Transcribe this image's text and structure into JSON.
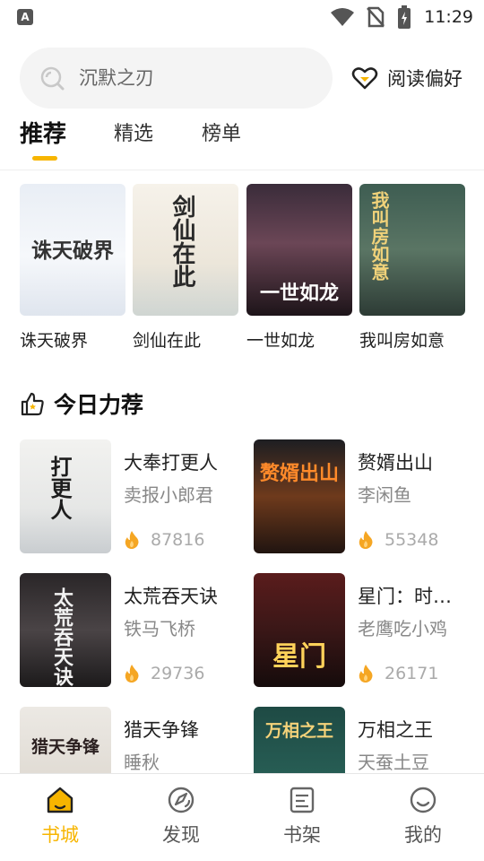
{
  "status_bar": {
    "app_badge": "A",
    "time": "11:29"
  },
  "search": {
    "text": "沉默之刃",
    "icon": "search-icon"
  },
  "preference": {
    "label": "阅读偏好",
    "icon": "heart-icon"
  },
  "tabs": [
    {
      "label": "推荐",
      "active": true
    },
    {
      "label": "精选",
      "active": false
    },
    {
      "label": "榜单",
      "active": false
    }
  ],
  "top_books": [
    {
      "title": "诛天破界",
      "cover_title": "诛天破界"
    },
    {
      "title": "剑仙在此",
      "cover_title": "剑仙在此"
    },
    {
      "title": "一世如龙",
      "cover_title": "一世如龙"
    },
    {
      "title": "我叫房如意",
      "cover_title": "我叫房如意"
    }
  ],
  "section": {
    "title": "今日力荐",
    "icon": "thumbs-up-icon"
  },
  "recommend": [
    {
      "title": "大奉打更人",
      "author": "卖报小郎君",
      "heat": "87816",
      "cover_title": "打更人"
    },
    {
      "title": "赘婿出山",
      "author": "李闲鱼",
      "heat": "55348",
      "cover_title": "赘婿出山"
    },
    {
      "title": "太荒吞天诀",
      "author": "铁马飞桥",
      "heat": "29736",
      "cover_title": "太荒吞天诀"
    },
    {
      "title": "星门：时…",
      "author": "老鹰吃小鸡",
      "heat": "26171",
      "cover_title": "星门"
    },
    {
      "title": "猎天争锋",
      "author": "睡秋",
      "heat": "",
      "cover_title": "猎天争锋"
    },
    {
      "title": "万相之王",
      "author": "天蚕土豆",
      "heat": "",
      "cover_title": "万相之王"
    }
  ],
  "bottom_nav": [
    {
      "label": "书城",
      "icon": "bookstore-icon",
      "active": true
    },
    {
      "label": "发现",
      "icon": "discover-icon",
      "active": false
    },
    {
      "label": "书架",
      "icon": "bookshelf-icon",
      "active": false
    },
    {
      "label": "我的",
      "icon": "profile-icon",
      "active": false
    }
  ],
  "colors": {
    "accent": "#f7b500",
    "text_primary": "#222222",
    "text_secondary": "#888888",
    "fire": "#f5a623"
  }
}
